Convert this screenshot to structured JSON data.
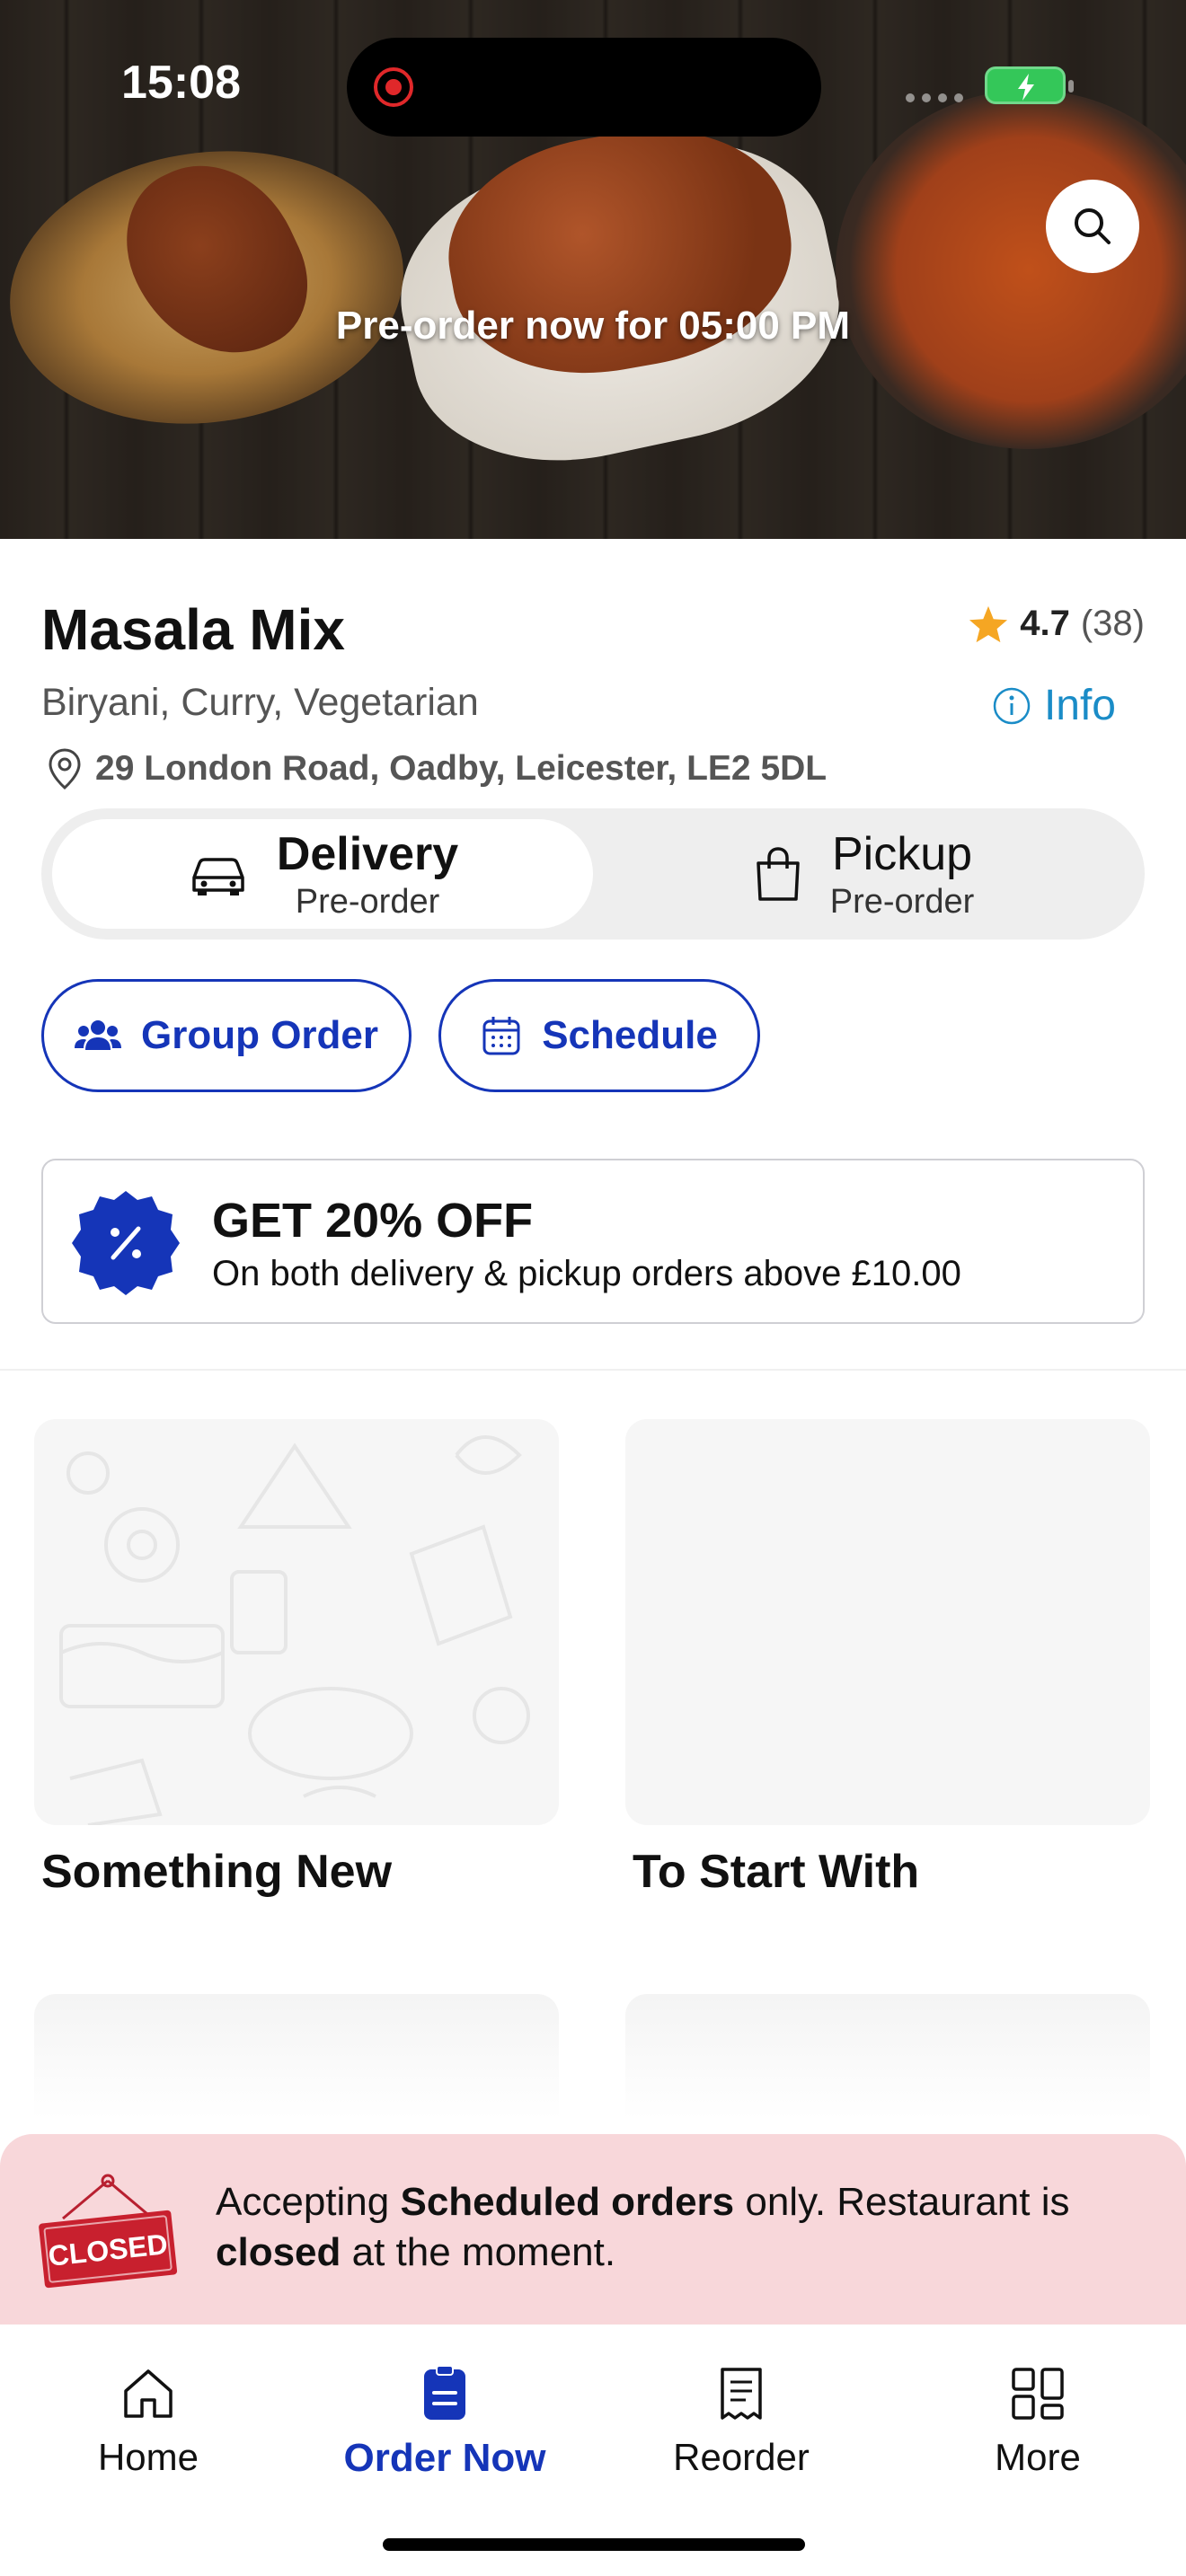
{
  "status_bar": {
    "time": "15:08"
  },
  "hero": {
    "preorder_text": "Pre-order now for 05:00 PM"
  },
  "restaurant": {
    "name": "Masala Mix",
    "rating": "4.7",
    "rating_count": "(38)",
    "cuisines": "Biryani, Curry, Vegetarian",
    "info_label": "Info",
    "address": "29 London Road, Oadby, Leicester, LE2 5DL"
  },
  "order_mode": {
    "delivery": {
      "label": "Delivery",
      "sub": "Pre-order",
      "selected": true
    },
    "pickup": {
      "label": "Pickup",
      "sub": "Pre-order",
      "selected": false
    }
  },
  "actions": {
    "group_order": "Group Order",
    "schedule": "Schedule"
  },
  "promo": {
    "title": "GET 20% OFF",
    "subtitle": "On both delivery & pickup orders above £10.00"
  },
  "categories": [
    {
      "title": "Something New"
    },
    {
      "title": "To Start With"
    }
  ],
  "closed_banner": {
    "sign_text": "CLOSED",
    "msg_1": "Accepting ",
    "msg_bold_1": "Scheduled orders",
    "msg_2": " only. Restaurant is ",
    "msg_bold_2": "closed",
    "msg_3": " at the moment."
  },
  "tabbar": {
    "home": "Home",
    "order_now": "Order Now",
    "reorder": "Reorder",
    "more": "More",
    "active": "order_now"
  },
  "colors": {
    "accent": "#1535b8",
    "info": "#1a8cc7",
    "star": "#f5a623",
    "closed_bg": "#f8d7da"
  }
}
